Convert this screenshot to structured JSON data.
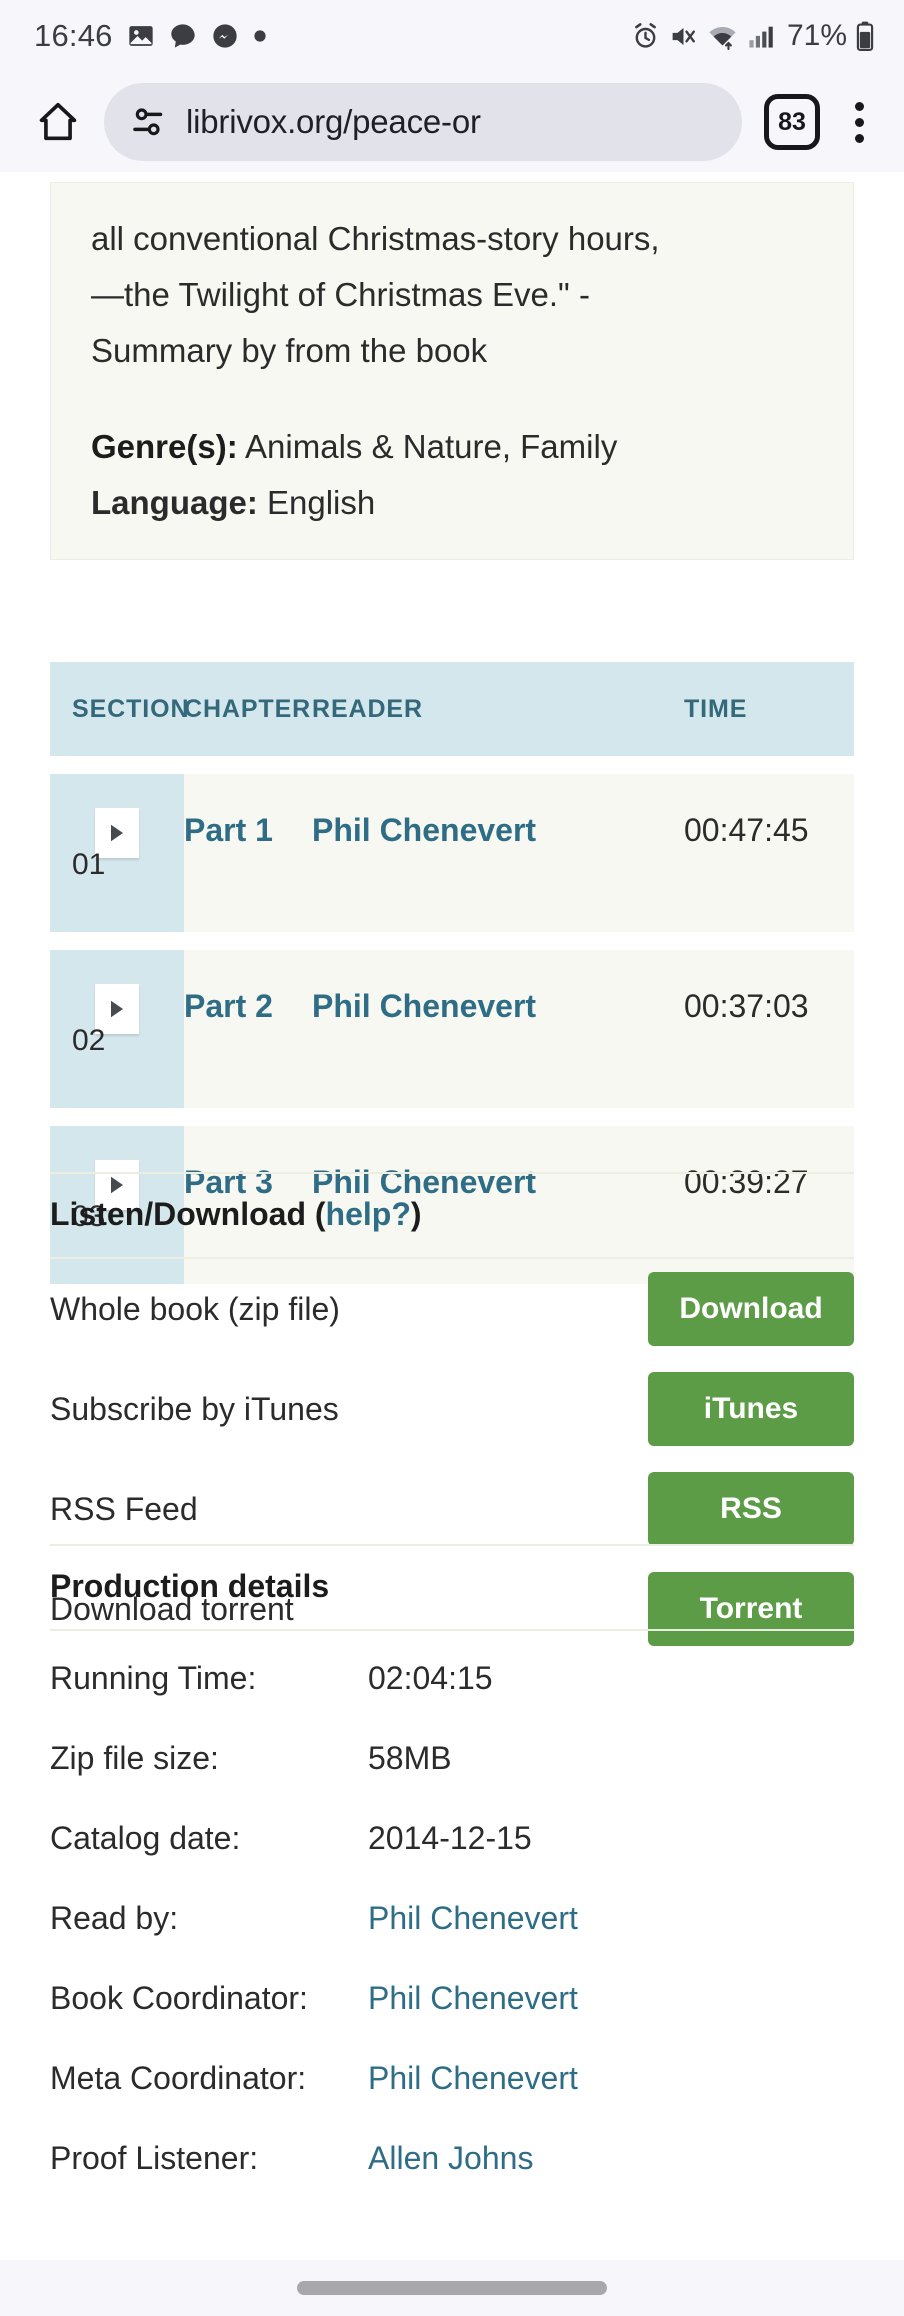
{
  "status_bar": {
    "time": "16:46",
    "battery_percent": "71%",
    "left_icons": [
      "photo-icon",
      "chat-bubble-icon",
      "messenger-icon",
      "dot-icon"
    ],
    "right_icons": [
      "alarm-icon",
      "mute-vibrate-icon",
      "wifi-icon",
      "signal-bars-icon",
      "battery-icon"
    ]
  },
  "browser": {
    "home_icon": "home-icon",
    "site_settings_icon": "tune-icon",
    "url": "librivox.org/peace-or",
    "tab_count": "83",
    "menu_icon": "more-vertical-icon"
  },
  "summary": {
    "line1": "all conventional Christmas-story hours,",
    "line2": "—the Twilight of Christmas Eve.\" -",
    "line3": "Summary by from the book",
    "genre_label": "Genre(s):",
    "genre_value": " Animals & Nature, Family",
    "language_label": "Language:",
    "language_value": " English"
  },
  "chapters_table": {
    "headers": {
      "section": "SECTION",
      "chapter": "CHAPTER",
      "reader": "READER",
      "time": "TIME"
    },
    "rows": [
      {
        "num": "01",
        "chapter": "Part 1",
        "reader": "Phil Chenevert",
        "time": "00:47:45",
        "play_icon": "play-icon"
      },
      {
        "num": "02",
        "chapter": "Part 2",
        "reader": "Phil Chenevert",
        "time": "00:37:03",
        "play_icon": "play-icon"
      },
      {
        "num": "03",
        "chapter": "Part 3",
        "reader": "Phil Chenevert",
        "time": "00:39:27",
        "play_icon": "play-icon"
      }
    ]
  },
  "listen_download": {
    "title": "Listen/Download (",
    "help_link": "help?",
    "title_end": ")",
    "rows": [
      {
        "label": "Whole book (zip file)",
        "button": "Download"
      },
      {
        "label": "Subscribe by iTunes",
        "button": "iTunes"
      },
      {
        "label": "RSS Feed",
        "button": "RSS"
      },
      {
        "label": "Download torrent",
        "button": "Torrent"
      }
    ]
  },
  "production_details": {
    "heading": "Production details",
    "rows": [
      {
        "key": "Running Time:",
        "value": "02:04:15",
        "is_link": false
      },
      {
        "key": "Zip file size:",
        "value": "58MB",
        "is_link": false
      },
      {
        "key": "Catalog date:",
        "value": "2014-12-15",
        "is_link": false
      },
      {
        "key": "Read by:",
        "value": "Phil Chenevert",
        "is_link": true
      },
      {
        "key": "Book Coordinator:",
        "value": "Phil Chenevert",
        "is_link": true
      },
      {
        "key": "Meta Coordinator:",
        "value": "Phil Chenevert",
        "is_link": true
      },
      {
        "key": "Proof Listener:",
        "value": "Allen Johns",
        "is_link": true
      }
    ]
  },
  "colors": {
    "accent_teal": "#2e6d85",
    "table_header_bg": "#d4e7ed",
    "button_green": "#5d9c46",
    "card_bg": "#f7f8f2"
  }
}
